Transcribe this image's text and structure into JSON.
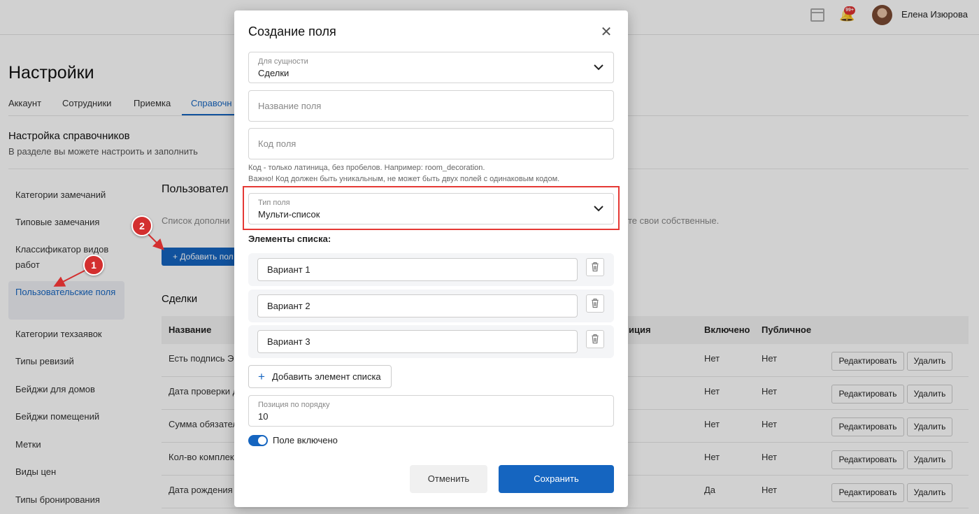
{
  "header": {
    "user_name": "Елена Изюрова",
    "notification_badge": "99+"
  },
  "page": {
    "title": "Настройки",
    "tabs": [
      {
        "label": "Аккаунт"
      },
      {
        "label": "Сотрудники"
      },
      {
        "label": "Приемка"
      },
      {
        "label": "Справочн"
      }
    ],
    "section_title": "Настройка справочников",
    "section_desc": "В разделе вы можете настроить и заполнить"
  },
  "sidebar": {
    "items": [
      {
        "label": "Категории замечаний"
      },
      {
        "label": "Типовые замечания"
      },
      {
        "label": "Классификатор видов работ"
      },
      {
        "label": "Пользовательские поля"
      },
      {
        "label": "Категории техзаявок"
      },
      {
        "label": "Типы ревизий"
      },
      {
        "label": "Бейджи для домов"
      },
      {
        "label": "Бейджи помещений"
      },
      {
        "label": "Метки"
      },
      {
        "label": "Виды цен"
      },
      {
        "label": "Типы бронирования"
      }
    ]
  },
  "custom_fields": {
    "title": "Пользовател",
    "desc_left": "Список дополни",
    "desc_right": "те свои собственные.",
    "add_button": "+ Добавить пол"
  },
  "deals": {
    "title": "Сделки",
    "headers": {
      "name": "Название",
      "position": "иция",
      "enabled": "Включено",
      "public": "Публичное"
    },
    "rows": [
      {
        "name": "Есть подпись ЭЦ",
        "enabled": "Нет",
        "public": "Нет"
      },
      {
        "name": "Дата проверки д",
        "enabled": "Нет",
        "public": "Нет"
      },
      {
        "name": "Сумма обязател",
        "enabled": "Нет",
        "public": "Нет"
      },
      {
        "name": "Кол-во комплект",
        "enabled": "Нет",
        "public": "Нет"
      },
      {
        "name": "Дата рождения д",
        "enabled": "Да",
        "public": "Нет"
      }
    ],
    "edit_label": "Редактировать",
    "delete_label": "Удалить"
  },
  "annotations": {
    "marker1": "1",
    "marker2": "2"
  },
  "modal": {
    "title": "Создание поля",
    "entity": {
      "label": "Для сущности",
      "value": "Сделки"
    },
    "name_placeholder": "Название поля",
    "code_placeholder": "Код поля",
    "hint1": "Код - только латиница, без пробелов. Например: room_decoration.",
    "hint2": "Важно! Код должен быть уникальным, не может быть двух полей с одинаковым кодом.",
    "field_type": {
      "label": "Тип поля",
      "value": "Мульти-список"
    },
    "list_label": "Элементы списка:",
    "list_items": [
      "Вариант 1",
      "Вариант 2",
      "Вариант 3"
    ],
    "add_item": "Добавить элемент списка",
    "position": {
      "label": "Позиция по порядку",
      "value": "10"
    },
    "toggle_label": "Поле включено",
    "toggle_on": true,
    "cancel": "Отменить",
    "save": "Сохранить",
    "accent_color": "#1565c0",
    "highlight_color": "#e53935"
  }
}
